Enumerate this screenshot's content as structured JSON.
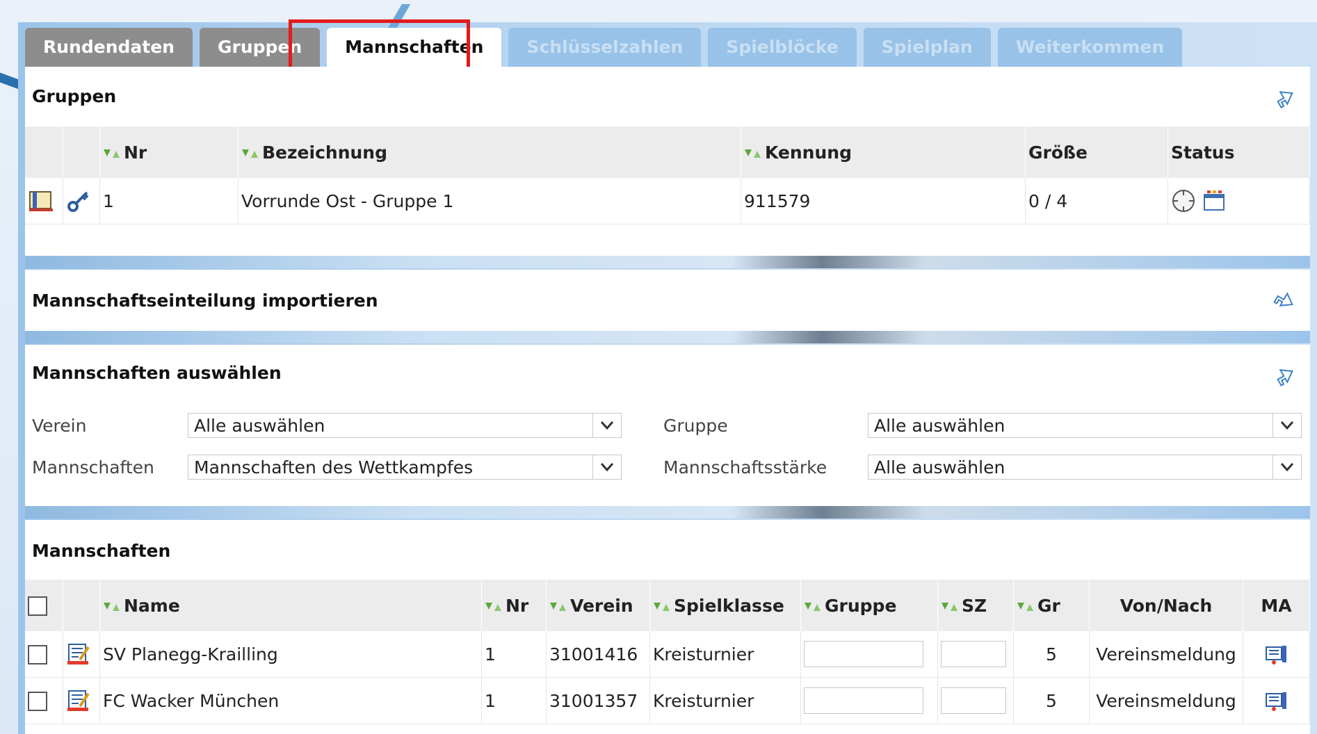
{
  "tabs": [
    {
      "label": "Rundendaten",
      "state": "normal"
    },
    {
      "label": "Gruppen",
      "state": "normal"
    },
    {
      "label": "Mannschaften",
      "state": "active"
    },
    {
      "label": "Schlüsselzahlen",
      "state": "disabled"
    },
    {
      "label": "Spielblöcke",
      "state": "disabled"
    },
    {
      "label": "Spielplan",
      "state": "disabled"
    },
    {
      "label": "Weiterkommen",
      "state": "disabled"
    }
  ],
  "gruppen": {
    "title": "Gruppen",
    "headers": {
      "nr": "Nr",
      "bezeichnung": "Bezeichnung",
      "kennung": "Kennung",
      "groesse": "Größe",
      "status": "Status"
    },
    "rows": [
      {
        "nr": "1",
        "bezeichnung": "Vorrunde Ost - Gruppe 1",
        "kennung": "911579",
        "groesse": "0 / 4"
      }
    ]
  },
  "import": {
    "title": "Mannschaftseinteilung importieren"
  },
  "auswahl": {
    "title": "Mannschaften auswählen",
    "verein_label": "Verein",
    "verein_value": "Alle auswählen",
    "mannschaften_label": "Mannschaften",
    "mannschaften_value": "Mannschaften des Wettkampfes",
    "gruppe_label": "Gruppe",
    "gruppe_value": "Alle auswählen",
    "staerke_label": "Mannschaftsstärke",
    "staerke_value": "Alle auswählen"
  },
  "mannschaften": {
    "title": "Mannschaften",
    "headers": {
      "name": "Name",
      "nr": "Nr",
      "verein": "Verein",
      "spielklasse": "Spielklasse",
      "gruppe": "Gruppe",
      "sz": "SZ",
      "gr": "Gr",
      "vonnach": "Von/Nach",
      "ma": "MA"
    },
    "rows": [
      {
        "name": "SV Planegg-Krailling",
        "nr": "1",
        "verein": "31001416",
        "spielklasse": "Kreisturnier",
        "gr": "5",
        "vonnach": "Vereinsmeldung"
      },
      {
        "name": "FC Wacker München",
        "nr": "1",
        "verein": "31001357",
        "spielklasse": "Kreisturnier",
        "gr": "5",
        "vonnach": "Vereinsmeldung"
      }
    ]
  },
  "colors": {
    "accent_highlight": "#e31b1b",
    "tab_normal": "#8d8d8d",
    "tab_disabled": "#98c2e8",
    "header_bg": "#ececec",
    "sort_arrows": "#5aa83b"
  }
}
